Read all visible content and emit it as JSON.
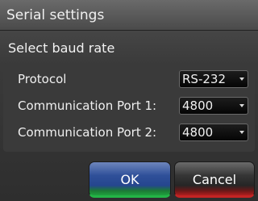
{
  "dialog": {
    "title": "Serial settings",
    "subtitle": "Select baud rate"
  },
  "rows": [
    {
      "label": "Protocol",
      "value": "RS-232"
    },
    {
      "label": "Communication Port 1:",
      "value": "4800"
    },
    {
      "label": "Communication Port 2:",
      "value": "4800"
    }
  ],
  "buttons": {
    "ok_label": "OK",
    "cancel_label": "Cancel"
  },
  "colors": {
    "ok_accent": "#23b446",
    "cancel_accent": "#c42424",
    "ok_face": "#25468f"
  },
  "icons": {
    "dropdown": "chevron-down-icon"
  }
}
